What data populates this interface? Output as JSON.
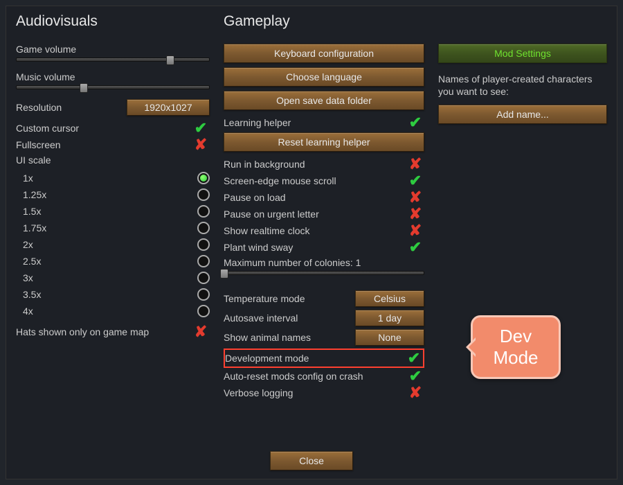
{
  "sections": {
    "audiovisuals": {
      "title": "Audiovisuals",
      "game_volume_label": "Game volume",
      "game_volume_pct": 80,
      "music_volume_label": "Music volume",
      "music_volume_pct": 35,
      "resolution_label": "Resolution",
      "resolution_value": "1920x1027",
      "custom_cursor_label": "Custom cursor",
      "custom_cursor_on": true,
      "fullscreen_label": "Fullscreen",
      "fullscreen_on": false,
      "ui_scale_label": "UI scale",
      "ui_scale_selected": "1x",
      "ui_scale_options": [
        "1x",
        "1.25x",
        "1.5x",
        "1.75x",
        "2x",
        "2.5x",
        "3x",
        "3.5x",
        "4x"
      ],
      "hats_label": "Hats shown only on game map",
      "hats_on": false
    },
    "gameplay": {
      "title": "Gameplay",
      "btn_keyboard": "Keyboard configuration",
      "btn_language": "Choose language",
      "btn_savefolder": "Open save data folder",
      "learning_helper_label": "Learning helper",
      "learning_helper_on": true,
      "btn_reset_learning": "Reset learning helper",
      "toggles": [
        {
          "label": "Run in background",
          "on": false
        },
        {
          "label": "Screen-edge mouse scroll",
          "on": true
        },
        {
          "label": "Pause on load",
          "on": false
        },
        {
          "label": "Pause on urgent letter",
          "on": false
        },
        {
          "label": "Show realtime clock",
          "on": false
        },
        {
          "label": "Plant wind sway",
          "on": true
        }
      ],
      "max_colonies_label": "Maximum number of colonies: 1",
      "max_colonies_pct": 0,
      "temperature_mode_label": "Temperature mode",
      "temperature_mode_value": "Celsius",
      "autosave_label": "Autosave interval",
      "autosave_value": "1 day",
      "animal_names_label": "Show animal names",
      "animal_names_value": "None",
      "dev_mode_label": "Development mode",
      "dev_mode_on": true,
      "auto_reset_mods_label": "Auto-reset mods config on crash",
      "auto_reset_mods_on": true,
      "verbose_logging_label": "Verbose logging",
      "verbose_logging_on": false
    },
    "right": {
      "mod_settings": "Mod Settings",
      "names_text": "Names of player-created characters you want to see:",
      "add_name": "Add name..."
    }
  },
  "close_label": "Close",
  "callout_line1": "Dev",
  "callout_line2": "Mode"
}
